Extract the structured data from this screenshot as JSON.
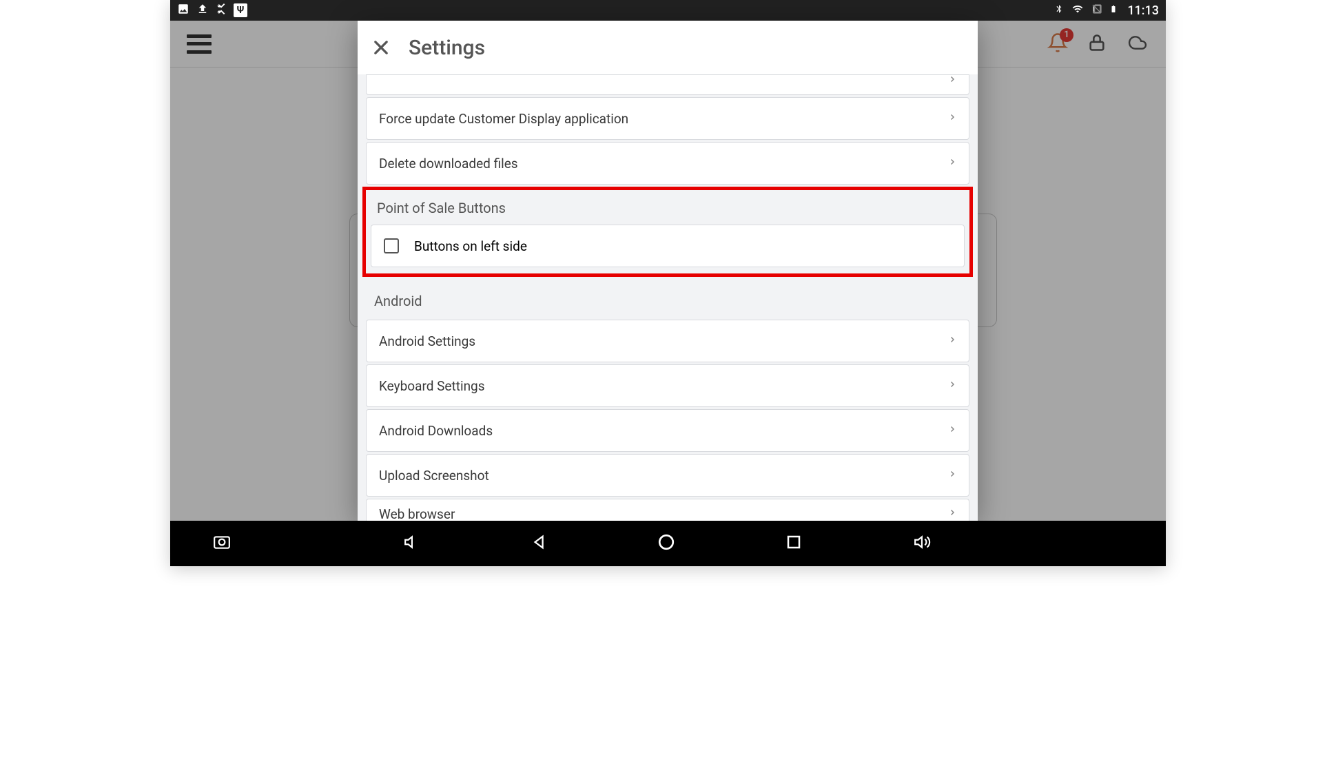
{
  "status_bar": {
    "time": "11:13"
  },
  "app_header": {
    "notification_badge": "1"
  },
  "dialog": {
    "title": "Settings",
    "sections": {
      "update": {
        "items": [
          {
            "label": "Force update Customer Display application"
          },
          {
            "label": "Delete downloaded files"
          }
        ]
      },
      "pos_buttons": {
        "header": "Point of Sale Buttons",
        "checkbox_label": "Buttons on left side",
        "checked": false
      },
      "android": {
        "header": "Android",
        "items": [
          {
            "label": "Android Settings"
          },
          {
            "label": "Keyboard Settings"
          },
          {
            "label": "Android Downloads"
          },
          {
            "label": "Upload Screenshot"
          },
          {
            "label": "Web browser"
          }
        ]
      }
    }
  }
}
